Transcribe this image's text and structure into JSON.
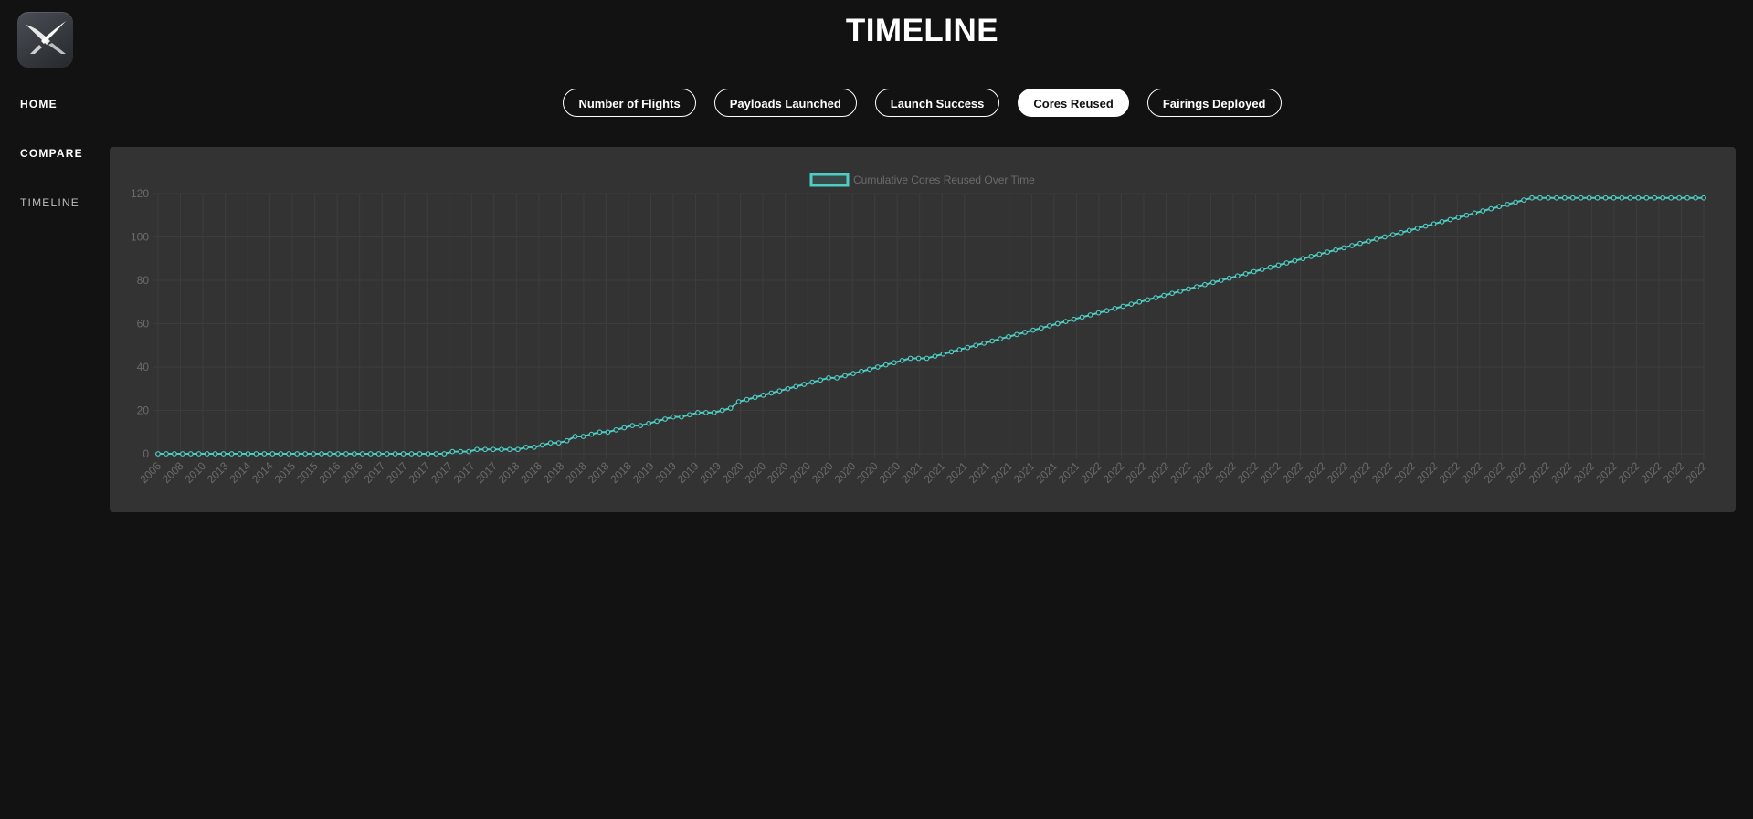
{
  "sidebar": {
    "logo_icon": "spacex-x-logo-icon",
    "items": [
      {
        "label": "HOME",
        "active": false
      },
      {
        "label": "COMPARE",
        "active": false
      },
      {
        "label": "TIMELINE",
        "active": true
      }
    ]
  },
  "page": {
    "title": "TIMELINE"
  },
  "tabs": [
    {
      "label": "Number of Flights",
      "active": false
    },
    {
      "label": "Payloads Launched",
      "active": false
    },
    {
      "label": "Launch Success",
      "active": false
    },
    {
      "label": "Cores Reused",
      "active": true
    },
    {
      "label": "Fairings Deployed",
      "active": false
    }
  ],
  "colors": {
    "background": "#121212",
    "card": "#333333",
    "series": "#4ecdc4",
    "grid": "#3d3d3d",
    "tick_text": "#6b6b6b"
  },
  "chart_data": {
    "type": "line",
    "legend": "top-center",
    "grid": true,
    "ylim": [
      0,
      120
    ],
    "yticks": [
      0,
      20,
      40,
      60,
      80,
      100,
      120
    ],
    "xticks": [
      "2006",
      "2008",
      "2010",
      "2013",
      "2014",
      "2014",
      "2015",
      "2015",
      "2016",
      "2016",
      "2017",
      "2017",
      "2017",
      "2017",
      "2017",
      "2017",
      "2018",
      "2018",
      "2018",
      "2018",
      "2018",
      "2018",
      "2019",
      "2019",
      "2019",
      "2019",
      "2020",
      "2020",
      "2020",
      "2020",
      "2020",
      "2020",
      "2020",
      "2020",
      "2021",
      "2021",
      "2021",
      "2021",
      "2021",
      "2021",
      "2021",
      "2021",
      "2022",
      "2022",
      "2022",
      "2022",
      "2022",
      "2022",
      "2022",
      "2022",
      "2022",
      "2022",
      "2022",
      "2022",
      "2022",
      "2022",
      "2022",
      "2022",
      "2022",
      "2022",
      "2022",
      "2022",
      "2022",
      "2022",
      "2022",
      "2022",
      "2022",
      "2022",
      "2022",
      "2022"
    ],
    "series": [
      {
        "name": "Cumulative Cores Reused Over Time",
        "values": [
          0,
          0,
          0,
          0,
          0,
          0,
          0,
          0,
          0,
          0,
          0,
          0,
          0,
          0,
          0,
          0,
          0,
          0,
          0,
          0,
          0,
          0,
          0,
          0,
          0,
          0,
          0,
          0,
          0,
          0,
          0,
          0,
          0,
          0,
          0,
          0,
          1,
          1,
          1,
          2,
          2,
          2,
          2,
          2,
          2,
          3,
          3,
          4,
          5,
          5,
          6,
          8,
          8,
          9,
          10,
          10,
          11,
          12,
          13,
          13,
          14,
          15,
          16,
          17,
          17,
          18,
          19,
          19,
          19,
          20,
          21,
          24,
          25,
          26,
          27,
          28,
          29,
          30,
          31,
          32,
          33,
          34,
          35,
          35,
          36,
          37,
          38,
          39,
          40,
          41,
          42,
          43,
          44,
          44,
          44,
          45,
          46,
          47,
          48,
          49,
          50,
          51,
          52,
          53,
          54,
          55,
          56,
          57,
          58,
          59,
          60,
          61,
          62,
          63,
          64,
          65,
          66,
          67,
          68,
          69,
          70,
          71,
          72,
          73,
          74,
          75,
          76,
          77,
          78,
          79,
          80,
          81,
          82,
          83,
          84,
          85,
          86,
          87,
          88,
          89,
          90,
          91,
          92,
          93,
          94,
          95,
          96,
          97,
          98,
          99,
          100,
          101,
          102,
          103,
          104,
          105,
          106,
          107,
          108,
          109,
          110,
          111,
          112,
          113,
          114,
          115,
          116,
          117,
          118,
          118,
          118,
          118,
          118,
          118,
          118,
          118,
          118,
          118,
          118,
          118,
          118,
          118,
          118,
          118,
          118,
          118,
          118,
          118,
          118,
          118
        ]
      }
    ]
  }
}
